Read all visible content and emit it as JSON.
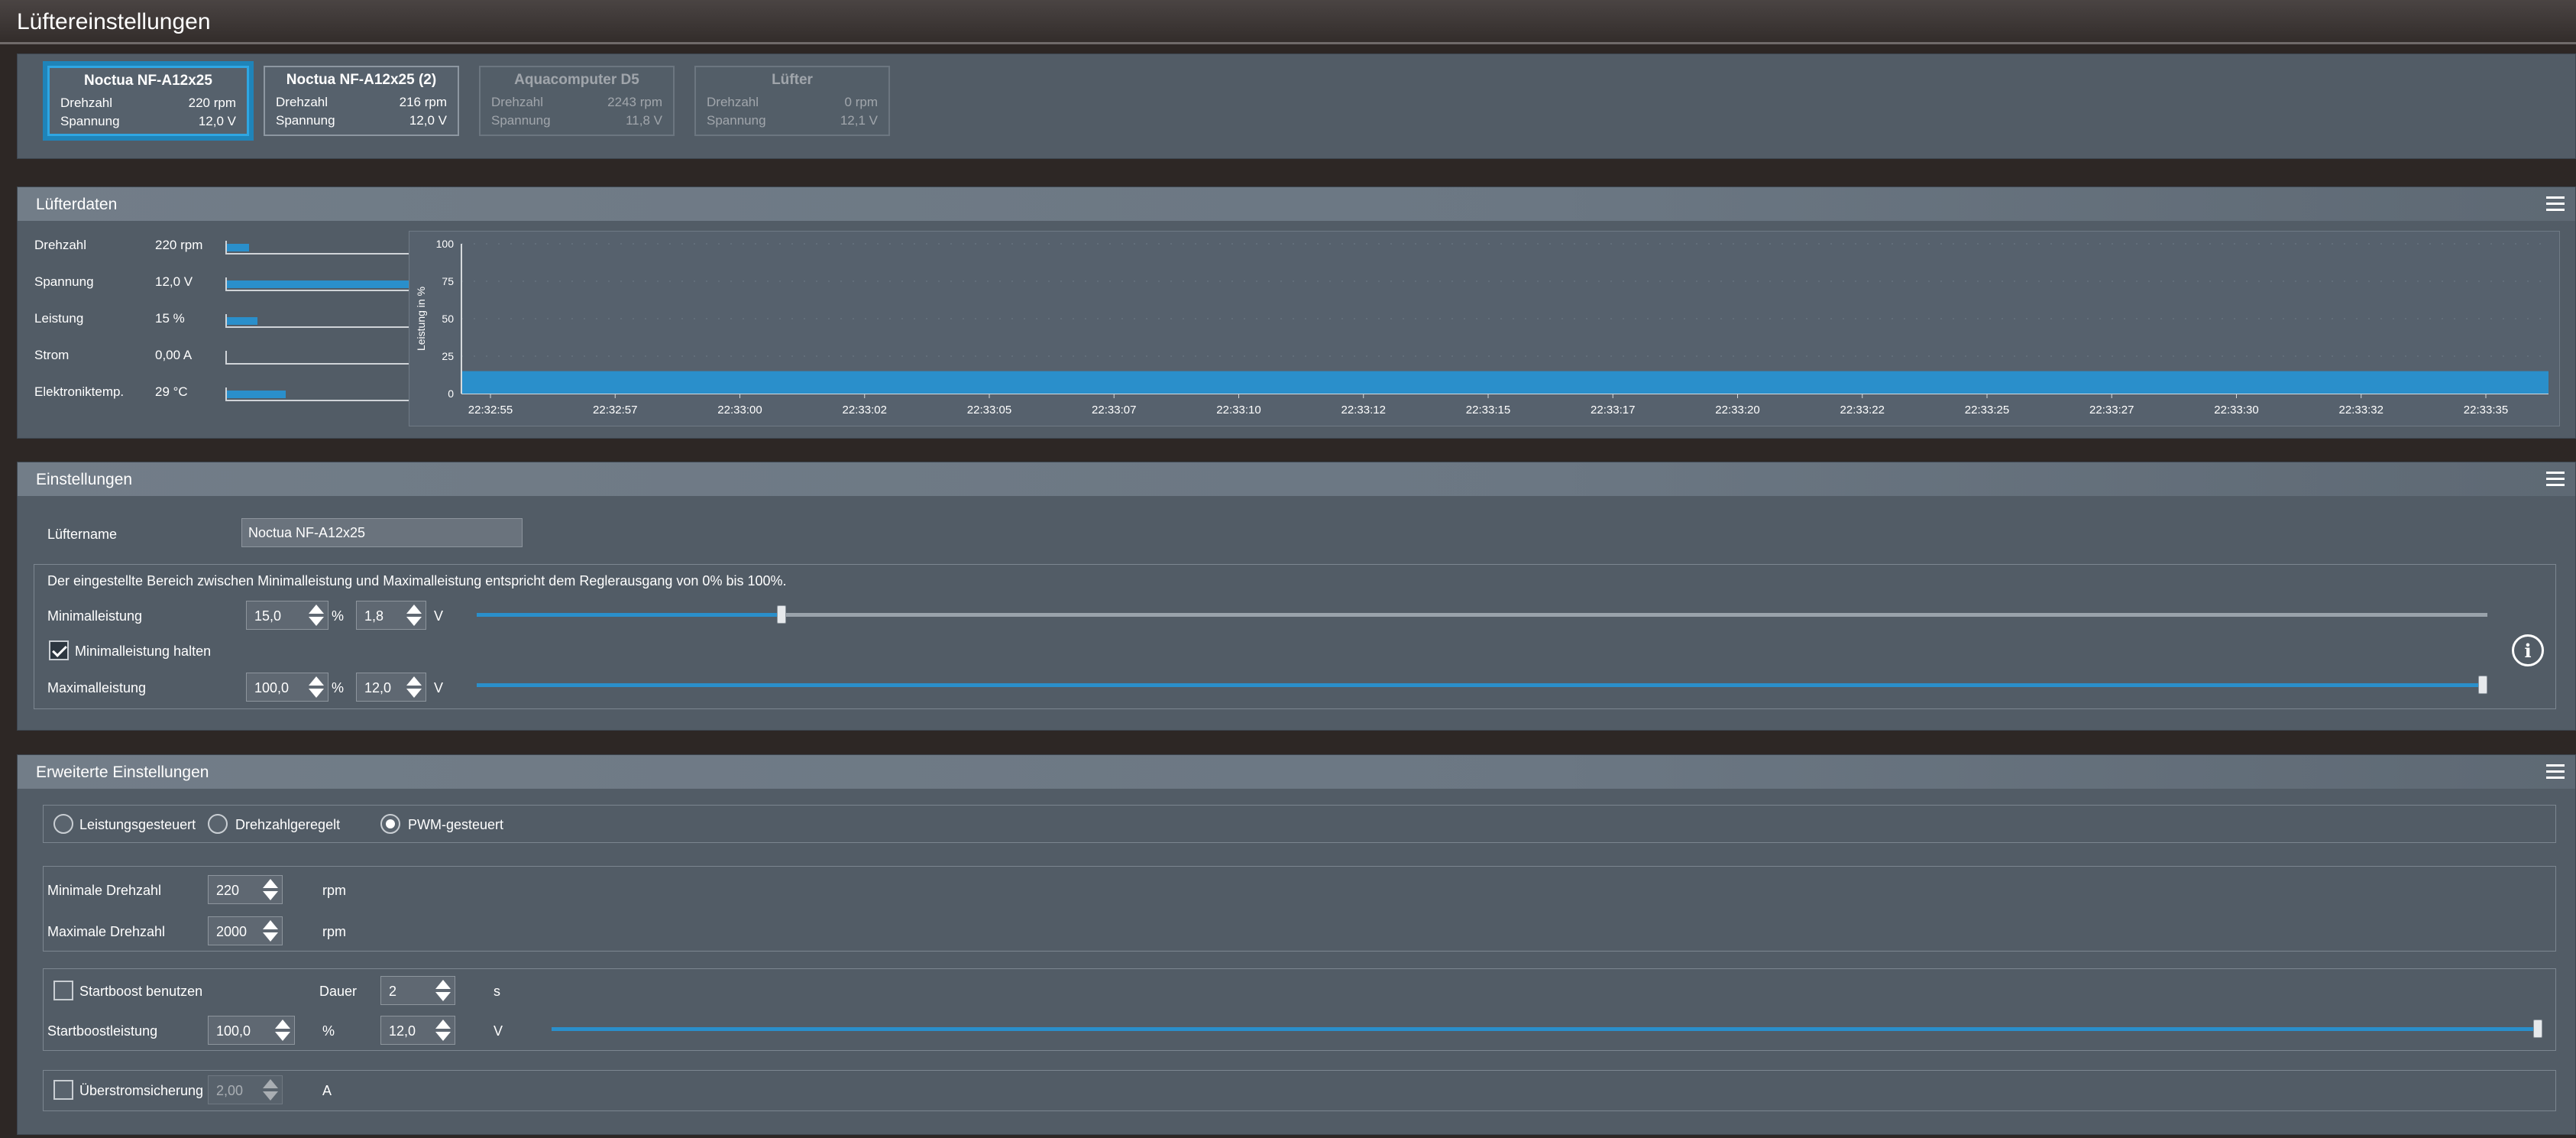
{
  "window": {
    "title": "Lüftereinstellungen"
  },
  "fans": [
    {
      "name": "Noctua NF-A12x25",
      "speed_label": "Drehzahl",
      "speed": "220 rpm",
      "voltage_label": "Spannung",
      "voltage": "12,0 V"
    },
    {
      "name": "Noctua NF-A12x25 (2)",
      "speed_label": "Drehzahl",
      "speed": "216 rpm",
      "voltage_label": "Spannung",
      "voltage": "12,0 V"
    },
    {
      "name": "Aquacomputer D5",
      "speed_label": "Drehzahl",
      "speed": "2243 rpm",
      "voltage_label": "Spannung",
      "voltage": "11,8 V"
    },
    {
      "name": "Lüfter",
      "speed_label": "Drehzahl",
      "speed": "0 rpm",
      "voltage_label": "Spannung",
      "voltage": "12,1 V"
    }
  ],
  "fandata": {
    "title": "Lüfterdaten",
    "rows": [
      {
        "label": "Drehzahl",
        "value": "220 rpm",
        "level": 0.11
      },
      {
        "label": "Spannung",
        "value": "12,0 V",
        "level": 1.0
      },
      {
        "label": "Leistung",
        "value": "15 %",
        "level": 0.15
      },
      {
        "label": "Strom",
        "value": "0,00 A",
        "level": 0.0
      },
      {
        "label": "Elektroniktemp.",
        "value": "29 °C",
        "level": 0.29
      }
    ]
  },
  "chart_data": {
    "type": "area",
    "ylabel": "Leistung in %",
    "ylim": [
      0,
      100
    ],
    "yticks": [
      "100",
      "75",
      "50",
      "25",
      "0"
    ],
    "x": [
      "22:32:55",
      "22:32:57",
      "22:33:00",
      "22:33:02",
      "22:33:05",
      "22:33:07",
      "22:33:10",
      "22:33:12",
      "22:33:15",
      "22:33:17",
      "22:33:20",
      "22:33:22",
      "22:33:25",
      "22:33:27",
      "22:33:30",
      "22:33:32",
      "22:33:35"
    ],
    "values": [
      15,
      15,
      15,
      15,
      15,
      15,
      15,
      15,
      15,
      15,
      15,
      15,
      15,
      15,
      15,
      15,
      15
    ],
    "grid": true,
    "color": "#2a8fcb"
  },
  "settings": {
    "title": "Einstellungen",
    "name_label": "Lüftername",
    "name_value": "Noctua NF-A12x25",
    "range_note": "Der eingestellte Bereich zwischen Minimalleistung und Maximalleistung entspricht dem Reglerausgang von 0% bis 100%.",
    "min_label": "Minimalleistung",
    "min_percent": "15,0",
    "min_volt": "1,8",
    "percent_unit": "%",
    "volt_unit": "V",
    "hold_min_label": "Minimalleistung halten",
    "hold_min_checked": true,
    "max_label": "Maximalleistung",
    "max_percent": "100,0",
    "max_volt": "12,0",
    "min_level": 0.15,
    "max_level": 1.0,
    "info_icon": "i"
  },
  "advanced": {
    "title": "Erweiterte Einstellungen",
    "modes": [
      "Leistungsgesteuert",
      "Drehzahlgeregelt",
      "PWM-gesteuert"
    ],
    "selected_mode": "PWM-gesteuert",
    "min_rpm_label": "Minimale Drehzahl",
    "min_rpm": "220",
    "max_rpm_label": "Maximale Drehzahl",
    "max_rpm": "2000",
    "rpm_unit": "rpm",
    "startboost_label": "Startboost benutzen",
    "duration_label": "Dauer",
    "duration": "2",
    "seconds_unit": "s",
    "boost_power_label": "Startboostleistung",
    "boost_percent": "100,0",
    "percent_unit": "%",
    "boost_volt": "12,0",
    "volt_unit": "V",
    "boost_level": 1.0,
    "overcurrent_label": "Überstromsicherung",
    "overcurrent_value": "2,00",
    "amp_unit": "A"
  },
  "colors": {
    "accent": "#2a8fcb",
    "selected_border": "#2fa6e3",
    "panel": "#525c66"
  }
}
